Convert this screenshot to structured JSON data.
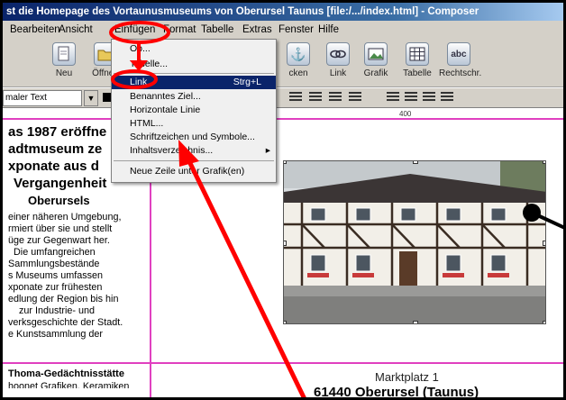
{
  "window": {
    "title": "st die Homepage des Vortaunusmuseums von Oberursel Taunus [file:/.../index.html] - Composer"
  },
  "menubar": {
    "items": [
      "Bearbeiten",
      "Ansicht",
      "Einfügen",
      "Format",
      "Tabelle",
      "Extras",
      "Fenster",
      "Hilfe"
    ]
  },
  "toolbar": {
    "buttons": [
      "Neu",
      "Öffnen",
      "",
      "",
      "",
      "",
      "",
      "",
      "cken",
      "Link",
      "Grafik",
      "Tabelle",
      "Rechtschr."
    ]
  },
  "format_bar": {
    "style_value": "maler Text"
  },
  "insert_menu": {
    "items": [
      {
        "label": "Ob...",
        "shortcut": ""
      },
      {
        "label": "Tabelle...",
        "shortcut": ""
      },
      {
        "label": "Link...",
        "shortcut": "Strg+L"
      },
      {
        "label": "Benanntes Ziel...",
        "shortcut": ""
      },
      {
        "label": "Horizontale Linie",
        "shortcut": ""
      },
      {
        "label": "HTML...",
        "shortcut": ""
      },
      {
        "label": "Schriftzeichen und Symbole...",
        "shortcut": ""
      },
      {
        "label": "Inhaltsverzeichnis...",
        "shortcut": ""
      },
      {
        "label": "Neue Zeile unter Grafik(en)",
        "shortcut": ""
      }
    ]
  },
  "document": {
    "ruler_label": "400",
    "heading_lines": [
      "as 1987 eröffne",
      "adtmuseum  ze",
      "xponate aus d",
      "Vergangenheit",
      "Oberursels"
    ],
    "body_lines": [
      "einer näheren Umgebung,",
      "rmiert über sie und stellt",
      "üge zur Gegenwart her.",
      "Die umfangreichen",
      "Sammlungsbestände",
      "s Museums umfassen",
      "xponate zur frühesten",
      "edlung der Region bis hin",
      "zur Industrie- und",
      "verksgeschichte der Stadt.",
      "e Kunstsammlung der"
    ],
    "section2_title": "Thoma-Gedächtnisstätte",
    "section2_line": "hoonet Grafiken, Keramiken",
    "address_street": "Marktplatz 1",
    "address_city": "61440 Oberursel (Taunus)"
  },
  "colors": {
    "titlebar": "#0a246a",
    "highlight": "#0a246a",
    "guide_lines": "#e040c0",
    "annotation": "#ff0000"
  }
}
